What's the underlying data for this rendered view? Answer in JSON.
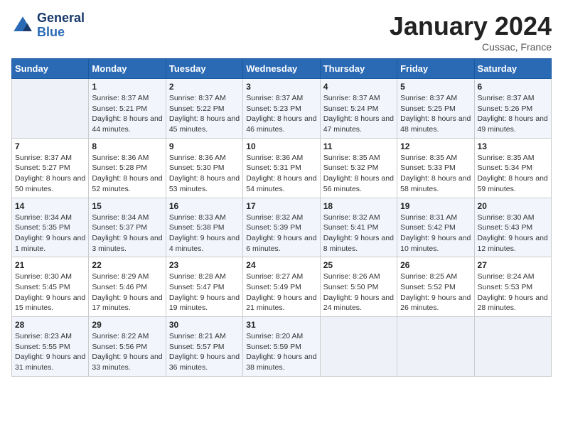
{
  "header": {
    "logo_line1": "General",
    "logo_line2": "Blue",
    "month": "January 2024",
    "location": "Cussac, France"
  },
  "weekdays": [
    "Sunday",
    "Monday",
    "Tuesday",
    "Wednesday",
    "Thursday",
    "Friday",
    "Saturday"
  ],
  "weeks": [
    [
      {
        "day": "",
        "sunrise": "",
        "sunset": "",
        "daylight": ""
      },
      {
        "day": "1",
        "sunrise": "8:37 AM",
        "sunset": "5:21 PM",
        "daylight": "8 hours and 44 minutes."
      },
      {
        "day": "2",
        "sunrise": "8:37 AM",
        "sunset": "5:22 PM",
        "daylight": "8 hours and 45 minutes."
      },
      {
        "day": "3",
        "sunrise": "8:37 AM",
        "sunset": "5:23 PM",
        "daylight": "8 hours and 46 minutes."
      },
      {
        "day": "4",
        "sunrise": "8:37 AM",
        "sunset": "5:24 PM",
        "daylight": "8 hours and 47 minutes."
      },
      {
        "day": "5",
        "sunrise": "8:37 AM",
        "sunset": "5:25 PM",
        "daylight": "8 hours and 48 minutes."
      },
      {
        "day": "6",
        "sunrise": "8:37 AM",
        "sunset": "5:26 PM",
        "daylight": "8 hours and 49 minutes."
      }
    ],
    [
      {
        "day": "7",
        "sunrise": "8:37 AM",
        "sunset": "5:27 PM",
        "daylight": "8 hours and 50 minutes."
      },
      {
        "day": "8",
        "sunrise": "8:36 AM",
        "sunset": "5:28 PM",
        "daylight": "8 hours and 52 minutes."
      },
      {
        "day": "9",
        "sunrise": "8:36 AM",
        "sunset": "5:30 PM",
        "daylight": "8 hours and 53 minutes."
      },
      {
        "day": "10",
        "sunrise": "8:36 AM",
        "sunset": "5:31 PM",
        "daylight": "8 hours and 54 minutes."
      },
      {
        "day": "11",
        "sunrise": "8:35 AM",
        "sunset": "5:32 PM",
        "daylight": "8 hours and 56 minutes."
      },
      {
        "day": "12",
        "sunrise": "8:35 AM",
        "sunset": "5:33 PM",
        "daylight": "8 hours and 58 minutes."
      },
      {
        "day": "13",
        "sunrise": "8:35 AM",
        "sunset": "5:34 PM",
        "daylight": "8 hours and 59 minutes."
      }
    ],
    [
      {
        "day": "14",
        "sunrise": "8:34 AM",
        "sunset": "5:35 PM",
        "daylight": "9 hours and 1 minute."
      },
      {
        "day": "15",
        "sunrise": "8:34 AM",
        "sunset": "5:37 PM",
        "daylight": "9 hours and 3 minutes."
      },
      {
        "day": "16",
        "sunrise": "8:33 AM",
        "sunset": "5:38 PM",
        "daylight": "9 hours and 4 minutes."
      },
      {
        "day": "17",
        "sunrise": "8:32 AM",
        "sunset": "5:39 PM",
        "daylight": "9 hours and 6 minutes."
      },
      {
        "day": "18",
        "sunrise": "8:32 AM",
        "sunset": "5:41 PM",
        "daylight": "9 hours and 8 minutes."
      },
      {
        "day": "19",
        "sunrise": "8:31 AM",
        "sunset": "5:42 PM",
        "daylight": "9 hours and 10 minutes."
      },
      {
        "day": "20",
        "sunrise": "8:30 AM",
        "sunset": "5:43 PM",
        "daylight": "9 hours and 12 minutes."
      }
    ],
    [
      {
        "day": "21",
        "sunrise": "8:30 AM",
        "sunset": "5:45 PM",
        "daylight": "9 hours and 15 minutes."
      },
      {
        "day": "22",
        "sunrise": "8:29 AM",
        "sunset": "5:46 PM",
        "daylight": "9 hours and 17 minutes."
      },
      {
        "day": "23",
        "sunrise": "8:28 AM",
        "sunset": "5:47 PM",
        "daylight": "9 hours and 19 minutes."
      },
      {
        "day": "24",
        "sunrise": "8:27 AM",
        "sunset": "5:49 PM",
        "daylight": "9 hours and 21 minutes."
      },
      {
        "day": "25",
        "sunrise": "8:26 AM",
        "sunset": "5:50 PM",
        "daylight": "9 hours and 24 minutes."
      },
      {
        "day": "26",
        "sunrise": "8:25 AM",
        "sunset": "5:52 PM",
        "daylight": "9 hours and 26 minutes."
      },
      {
        "day": "27",
        "sunrise": "8:24 AM",
        "sunset": "5:53 PM",
        "daylight": "9 hours and 28 minutes."
      }
    ],
    [
      {
        "day": "28",
        "sunrise": "8:23 AM",
        "sunset": "5:55 PM",
        "daylight": "9 hours and 31 minutes."
      },
      {
        "day": "29",
        "sunrise": "8:22 AM",
        "sunset": "5:56 PM",
        "daylight": "9 hours and 33 minutes."
      },
      {
        "day": "30",
        "sunrise": "8:21 AM",
        "sunset": "5:57 PM",
        "daylight": "9 hours and 36 minutes."
      },
      {
        "day": "31",
        "sunrise": "8:20 AM",
        "sunset": "5:59 PM",
        "daylight": "9 hours and 38 minutes."
      },
      {
        "day": "",
        "sunrise": "",
        "sunset": "",
        "daylight": ""
      },
      {
        "day": "",
        "sunrise": "",
        "sunset": "",
        "daylight": ""
      },
      {
        "day": "",
        "sunrise": "",
        "sunset": "",
        "daylight": ""
      }
    ]
  ],
  "labels": {
    "sunrise_prefix": "Sunrise: ",
    "sunset_prefix": "Sunset: ",
    "daylight_prefix": "Daylight: "
  }
}
